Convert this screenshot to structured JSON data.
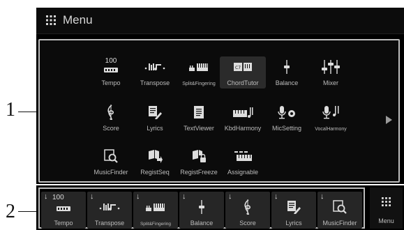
{
  "callouts": {
    "one": "1",
    "two": "2"
  },
  "titlebar": {
    "icon": "menu-grid-icon",
    "title": "Menu"
  },
  "grid": [
    {
      "label": "Tempo",
      "icon": "tempo-icon",
      "top_text": "100"
    },
    {
      "label": "Transpose",
      "icon": "transpose-icon"
    },
    {
      "label": "Split&Fingering",
      "icon": "split-fingering-icon"
    },
    {
      "label": "ChordTutor",
      "icon": "chord-tutor-icon",
      "selected": true
    },
    {
      "label": "Balance",
      "icon": "balance-icon"
    },
    {
      "label": "Mixer",
      "icon": "mixer-icon"
    },
    {
      "label": "Score",
      "icon": "score-icon"
    },
    {
      "label": "Lyrics",
      "icon": "lyrics-icon"
    },
    {
      "label": "TextViewer",
      "icon": "text-viewer-icon"
    },
    {
      "label": "KbdHarmony",
      "icon": "kbd-harmony-icon"
    },
    {
      "label": "MicSetting",
      "icon": "mic-setting-icon"
    },
    {
      "label": "VocalHarmony",
      "icon": "vocal-harmony-icon"
    },
    {
      "label": "MusicFinder",
      "icon": "music-finder-icon"
    },
    {
      "label": "RegistSeq",
      "icon": "regist-seq-icon"
    },
    {
      "label": "RegistFreeze",
      "icon": "regist-freeze-icon"
    },
    {
      "label": "Assignable",
      "icon": "assignable-icon"
    }
  ],
  "registration": [
    {
      "label": "Tempo",
      "icon": "tempo-icon",
      "top_text": "100"
    },
    {
      "label": "Transpose",
      "icon": "transpose-icon"
    },
    {
      "label": "Split&Fingering",
      "icon": "split-fingering-icon"
    },
    {
      "label": "Balance",
      "icon": "balance-icon"
    },
    {
      "label": "Score",
      "icon": "score-icon"
    },
    {
      "label": "Lyrics",
      "icon": "lyrics-icon"
    },
    {
      "label": "MusicFinder",
      "icon": "music-finder-icon"
    }
  ],
  "menu_button": {
    "label": "Menu",
    "icon": "menu-grid-icon"
  }
}
